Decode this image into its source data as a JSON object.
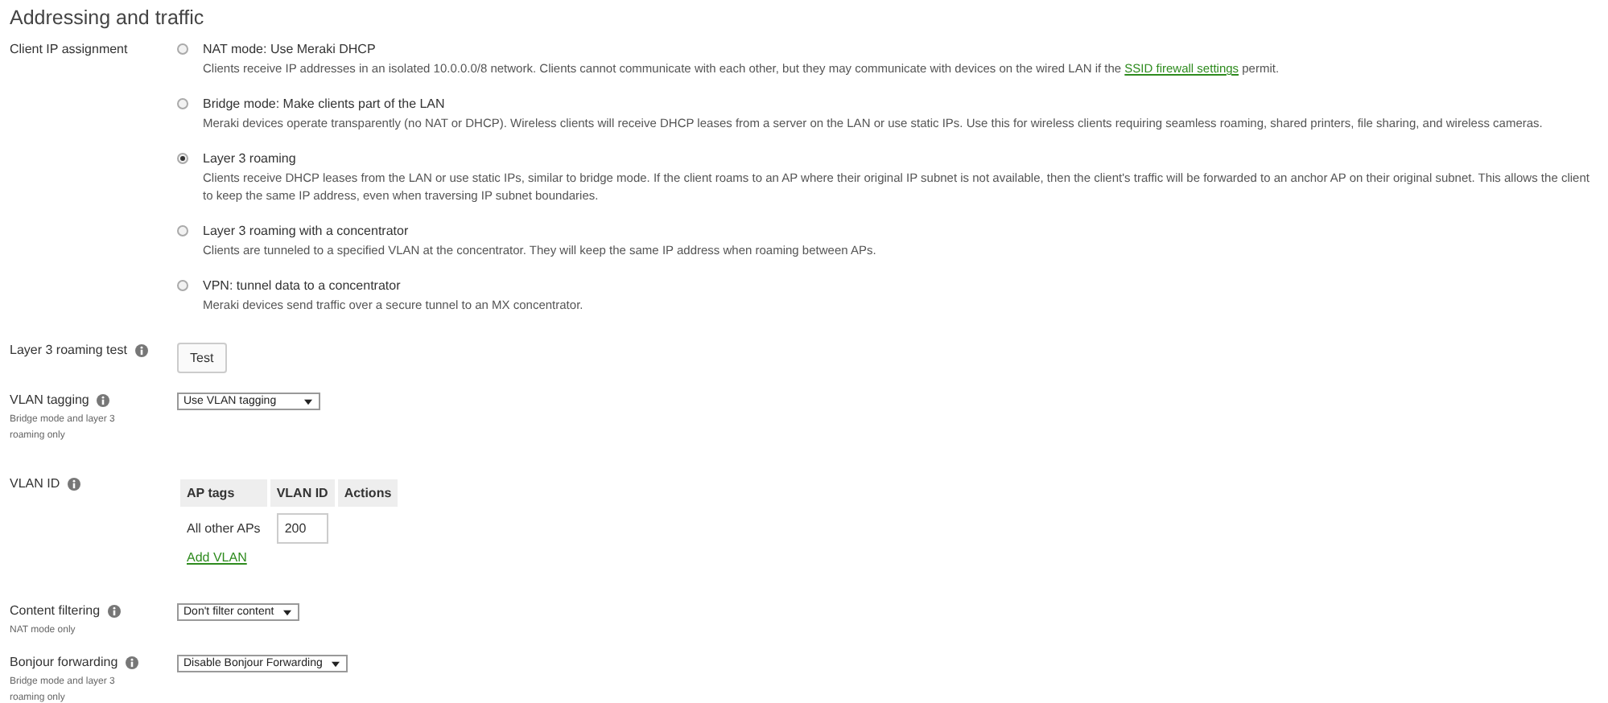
{
  "section": {
    "title": "Addressing and traffic"
  },
  "client_ip": {
    "label": "Client IP assignment",
    "options": [
      {
        "title": "NAT mode: Use Meraki DHCP",
        "description": "Clients receive IP addresses in an isolated 10.0.0.0/8 network. Clients cannot communicate with each other, but they may communicate with devices on the wired LAN if the",
        "link": "SSID firewall settings",
        "description_end": "permit.",
        "selected": false
      },
      {
        "title": "Bridge mode: Make clients part of the LAN",
        "description": "Meraki devices operate transparently (no NAT or DHCP). Wireless clients will receive DHCP leases from a server on the LAN or use static IPs. Use this for wireless clients requiring seamless roaming, shared printers, file sharing, and wireless cameras.",
        "selected": false
      },
      {
        "title": "Layer 3 roaming",
        "description": "Clients receive DHCP leases from the LAN or use static IPs, similar to bridge mode. If the client roams to an AP where their original IP subnet is not available, then the client's traffic will be forwarded to an anchor AP on their original subnet. This allows the client to keep the same IP address, even when traversing IP subnet boundaries.",
        "selected": true
      },
      {
        "title": "Layer 3 roaming with a concentrator",
        "description": "Clients are tunneled to a specified VLAN at the concentrator. They will keep the same IP address when roaming between APs.",
        "selected": false
      },
      {
        "title": "VPN: tunnel data to a concentrator",
        "description": "Meraki devices send traffic over a secure tunnel to an MX concentrator.",
        "selected": false
      }
    ]
  },
  "settings": [
    {
      "kind": "button",
      "label": "Layer 3 roaming test",
      "value": "Test"
    },
    {
      "kind": "select",
      "label": "VLAN tagging",
      "note": "Bridge mode and layer 3 roaming only",
      "value": "Use VLAN tagging"
    },
    {
      "kind": "table",
      "label": "VLAN ID",
      "columns": [
        "AP tags",
        "VLAN ID",
        "Actions"
      ],
      "rows": [
        {
          "tags": "All other APs",
          "vlan": "200"
        }
      ],
      "add_link": "Add VLAN"
    },
    {
      "kind": "select",
      "label": "Content filtering",
      "note": "NAT mode only",
      "value": "Don't filter content"
    },
    {
      "kind": "select",
      "label": "Bonjour forwarding",
      "note": "Bridge mode and layer 3 roaming only",
      "value": "Disable Bonjour Forwarding"
    }
  ]
}
